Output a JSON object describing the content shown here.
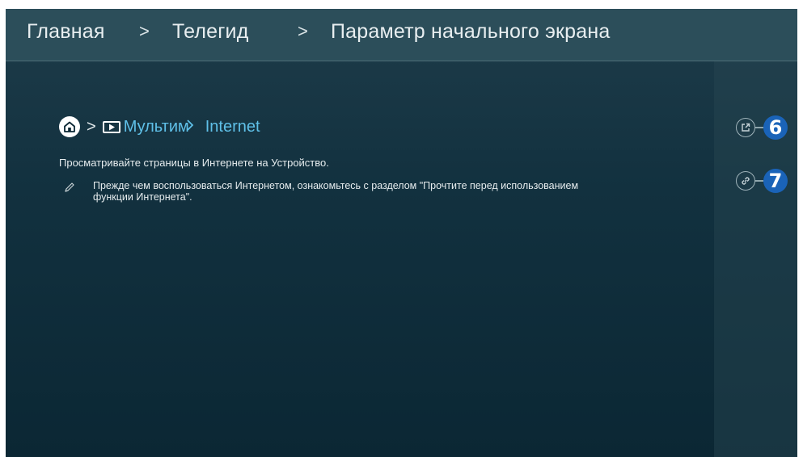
{
  "header": {
    "breadcrumb": [
      "Главная",
      "Телегид",
      "Параметр начального экрана"
    ],
    "separator": ">"
  },
  "path": {
    "home_icon": "home-icon",
    "separator": ">",
    "media_icon": "media-play-icon",
    "item1": "Мультим",
    "item2": "Internet",
    "accent_color": "#5fc0e8"
  },
  "content": {
    "description": "Просматривайте страницы в Интернете на Устройство.",
    "note": "Прежде чем воспользоваться Интернетом, ознакомьтесь с разделом \"Прочтите перед использованием функции Интернета\".",
    "note_icon": "pencil-icon"
  },
  "side_buttons": [
    {
      "icon": "external-link-icon",
      "badge": "6"
    },
    {
      "icon": "link-icon",
      "badge": "7"
    }
  ],
  "colors": {
    "badge": "#1a63b8",
    "header": "#2c4e5a"
  }
}
